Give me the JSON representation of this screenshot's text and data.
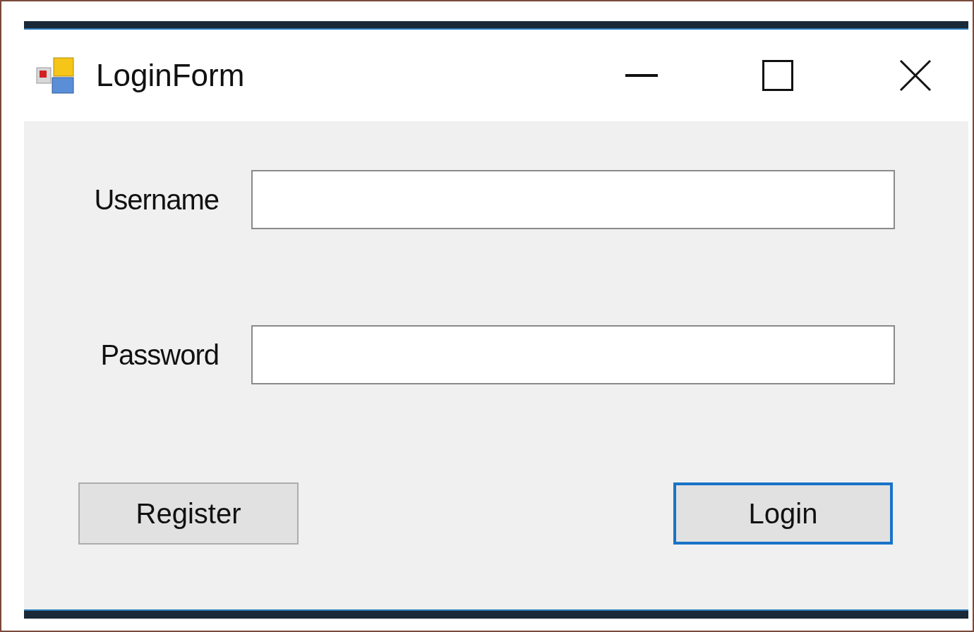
{
  "window": {
    "title": "LoginForm"
  },
  "fields": [
    {
      "label": "Username"
    },
    {
      "label": "Password"
    }
  ],
  "buttons": [
    {
      "label": "Register",
      "focused": false
    },
    {
      "label": "Login",
      "focused": true
    }
  ]
}
